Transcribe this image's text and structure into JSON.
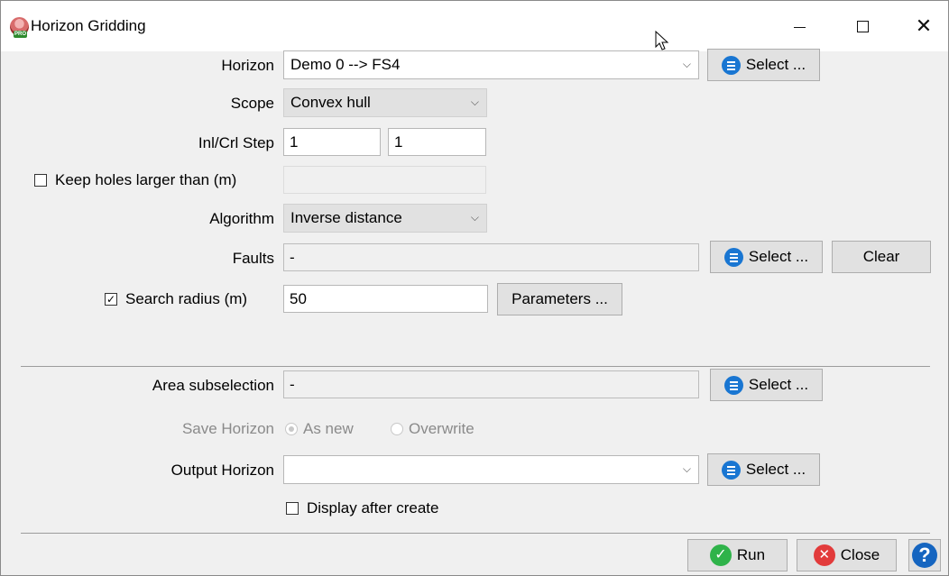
{
  "window": {
    "title": "Horizon Gridding",
    "minimize": "—",
    "maximize": "☐",
    "close": "✕"
  },
  "horizon": {
    "label": "Horizon",
    "value": "Demo 0 --> FS4",
    "select": "Select ..."
  },
  "scope": {
    "label": "Scope",
    "value": "Convex hull"
  },
  "step": {
    "label": "Inl/Crl Step",
    "inline": "1",
    "crossline": "1"
  },
  "holes": {
    "label": "Keep holes larger than (m)",
    "checked": false,
    "value": ""
  },
  "algorithm": {
    "label": "Algorithm",
    "value": "Inverse distance"
  },
  "faults": {
    "label": "Faults",
    "value": "-",
    "select": "Select ...",
    "clear": "Clear"
  },
  "search_radius": {
    "label": "Search radius (m)",
    "checked": true,
    "value": "50",
    "parameters": "Parameters ..."
  },
  "area": {
    "label": "Area subselection",
    "value": "-",
    "select": "Select ..."
  },
  "save": {
    "label": "Save Horizon",
    "as_new": "As new",
    "overwrite": "Overwrite",
    "selected": "as_new"
  },
  "output": {
    "label": "Output Horizon",
    "value": "",
    "select": "Select ..."
  },
  "display_after": {
    "label": "Display after create",
    "checked": false
  },
  "footer": {
    "run": "Run",
    "close": "Close",
    "help": "?"
  },
  "icons": {
    "checked_glyph": "✓",
    "chevron": "⌵",
    "run": "✓",
    "close": "✕"
  }
}
